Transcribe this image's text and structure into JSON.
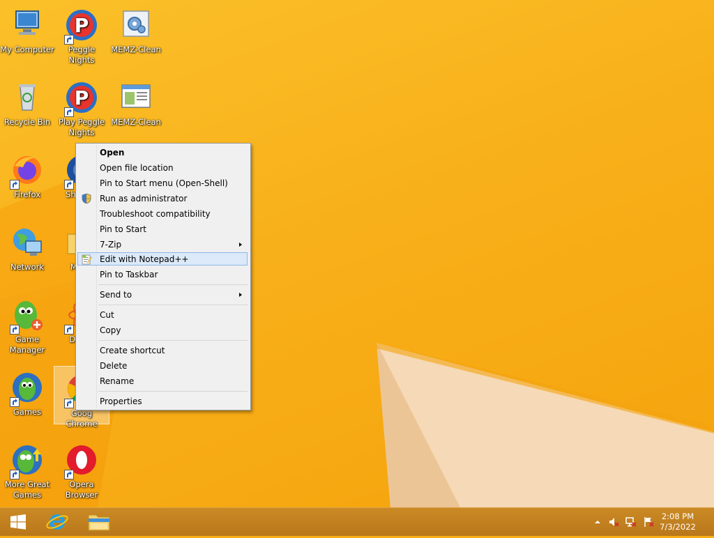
{
  "desktop": {
    "icons": [
      {
        "label": "My Computer",
        "icon": "computer-icon"
      },
      {
        "label": "Peggle Nights",
        "icon": "peggle-icon"
      },
      {
        "label": "MEMZ-Clean",
        "icon": "settings-icon"
      },
      {
        "label": "Recycle Bin",
        "icon": "recycle-bin-icon"
      },
      {
        "label": "Play Peggle Nights",
        "icon": "peggle-icon"
      },
      {
        "label": "MEMZ-Clean",
        "icon": "window-icon"
      },
      {
        "label": "Firefox",
        "icon": "firefox-icon"
      },
      {
        "label": "Shor Ga",
        "icon": "games-icon"
      },
      {
        "label": "Network",
        "icon": "network-icon"
      },
      {
        "label": "MEI C",
        "icon": "folder-icon"
      },
      {
        "label": "Game Manager",
        "icon": "game-manager-icon"
      },
      {
        "label": "DataV",
        "icon": "datav-icon"
      },
      {
        "label": "Games",
        "icon": "games-icon"
      },
      {
        "label": "Goog Chrome",
        "icon": "chrome-icon"
      },
      {
        "label": "More Great Games",
        "icon": "more-games-icon"
      },
      {
        "label": "Opera Browser",
        "icon": "opera-icon"
      }
    ]
  },
  "context_menu": {
    "items": {
      "open": "Open",
      "open_location": "Open file location",
      "pin_start_menu": "Pin to Start menu (Open-Shell)",
      "run_admin": "Run as administrator",
      "troubleshoot": "Troubleshoot compatibility",
      "pin_start": "Pin to Start",
      "zip": "7-Zip",
      "notepadpp": "Edit with Notepad++",
      "pin_taskbar": "Pin to Taskbar",
      "send_to": "Send to",
      "cut": "Cut",
      "copy": "Copy",
      "create_shortcut": "Create shortcut",
      "delete": "Delete",
      "rename": "Rename",
      "properties": "Properties"
    },
    "highlighted": "Edit with Notepad++"
  },
  "taskbar": {
    "clock_time": "2:08 PM",
    "clock_date": "7/3/2022",
    "accent": "#c1801f"
  }
}
